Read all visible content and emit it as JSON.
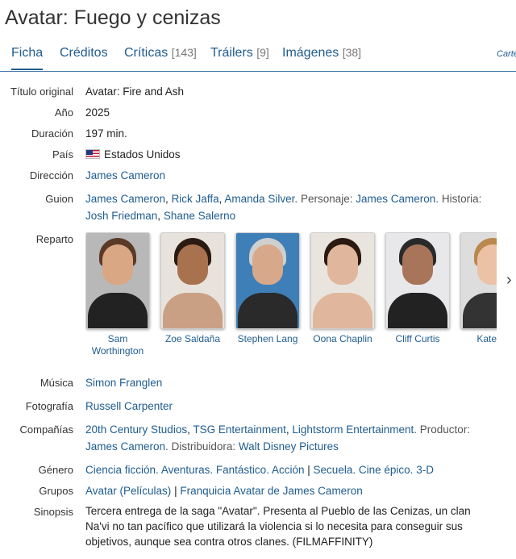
{
  "title": "Avatar: Fuego y cenizas",
  "tabs": [
    {
      "label": "Ficha",
      "count": ""
    },
    {
      "label": "Créditos",
      "count": ""
    },
    {
      "label": "Críticas",
      "count": "[143]"
    },
    {
      "label": "Tráilers",
      "count": "[9]"
    },
    {
      "label": "Imágenes",
      "count": "[38]"
    },
    {
      "label": "Carte",
      "count": ""
    }
  ],
  "info": {
    "titulo_original": {
      "label": "Título original",
      "value": "Avatar: Fire and Ash"
    },
    "anio": {
      "label": "Año",
      "value": "2025"
    },
    "duracion": {
      "label": "Duración",
      "value": "197 min."
    },
    "pais": {
      "label": "País",
      "value": "Estados Unidos",
      "flag_icon": "us-flag-icon"
    },
    "direccion": {
      "label": "Dirección",
      "value": "James Cameron"
    },
    "guion": {
      "label": "Guion",
      "writers": [
        "James Cameron",
        "Rick Jaffa",
        "Amanda Silver"
      ],
      "personaje_label": "Personaje:",
      "personaje": "James Cameron",
      "historia_label": "Historia:",
      "historia": [
        "Josh Friedman",
        "Shane Salerno"
      ]
    },
    "reparto": {
      "label": "Reparto",
      "cast": [
        {
          "name": "Sam Worthington",
          "skin": "#d9a783",
          "hair": "#5a3a26",
          "bg": "#b8b8b8",
          "body": "#222"
        },
        {
          "name": "Zoe Saldaña",
          "skin": "#a8724f",
          "hair": "#2a1a12",
          "bg": "#e8e2dc",
          "body": "#caa085"
        },
        {
          "name": "Stephen Lang",
          "skin": "#d8a88a",
          "hair": "#cfcfcf",
          "bg": "#3f7fb8",
          "body": "#2a2a2a"
        },
        {
          "name": "Oona Chaplin",
          "skin": "#e0b79c",
          "hair": "#2b1a12",
          "bg": "#e9e4de",
          "body": "#e0b79c"
        },
        {
          "name": "Cliff Curtis",
          "skin": "#a8755a",
          "hair": "#2a2a2a",
          "bg": "#e8e8ea",
          "body": "#222"
        },
        {
          "name": "Kate W",
          "skin": "#ecc2a6",
          "hair": "#b9884e",
          "bg": "#ddd",
          "body": "#333"
        }
      ]
    },
    "musica": {
      "label": "Música",
      "value": "Simon Franglen"
    },
    "fotografia": {
      "label": "Fotografía",
      "value": "Russell Carpenter"
    },
    "companias": {
      "label": "Compañías",
      "studios": [
        "20th Century Studios",
        "TSG Entertainment",
        "Lightstorm Entertainment"
      ],
      "productor_label": "Productor:",
      "productor": "James Cameron",
      "distribuidora_label": "Distribuidora:",
      "distribuidora": "Walt Disney Pictures"
    },
    "genero": {
      "label": "Género",
      "genres": [
        "Ciencia ficción",
        "Aventuras",
        "Fantástico",
        "Acción"
      ],
      "sep": "|",
      "tags": [
        "Secuela",
        "Cine épico",
        "3-D"
      ]
    },
    "grupos": {
      "label": "Grupos",
      "groups": [
        "Avatar (Películas)",
        "Franquicia Avatar de James Cameron"
      ]
    },
    "sinopsis": {
      "label": "Sinopsis",
      "text": "Tercera entrega de la saga \"Avatar\". Presenta al Pueblo de las Cenizas, un clan Na'vi no tan pacífico que utilizará la violencia si lo necesita para conseguir sus objetivos, aunque sea contra otros clanes. (FILMAFFINITY)"
    }
  }
}
